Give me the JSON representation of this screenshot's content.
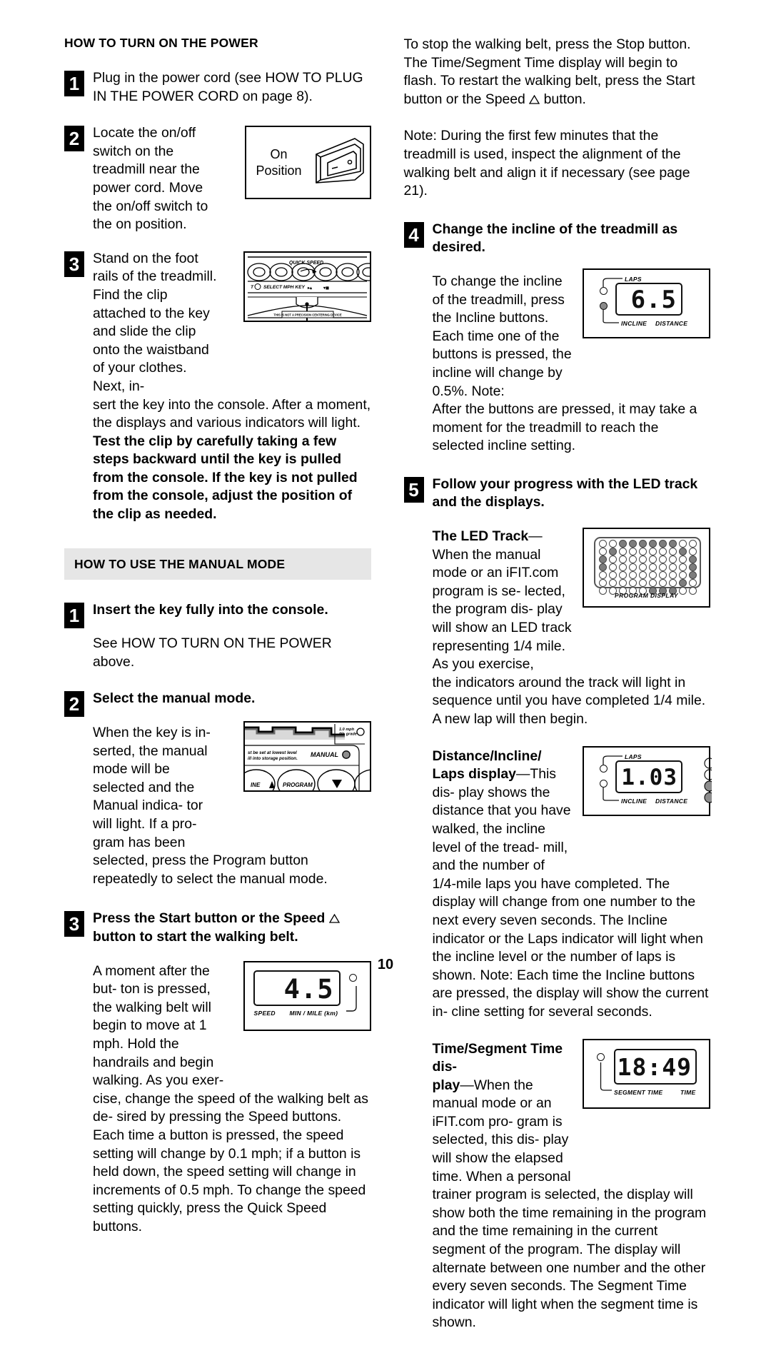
{
  "page": {
    "number": "10"
  },
  "left": {
    "section1": {
      "title": "HOW TO TURN ON THE POWER",
      "steps": [
        {
          "num": "1",
          "text": "Plug in the power cord (see HOW TO PLUG IN THE POWER CORD on page 8)."
        },
        {
          "num": "2",
          "text": "Locate the on/off switch on the treadmill near the power cord. Move the on/off switch to the on position.",
          "figure": {
            "name": "on-position-switch",
            "label_line1": "On",
            "label_line2": "Position"
          }
        },
        {
          "num": "3",
          "text": "Stand on the foot rails of the treadmill. Find the clip attached to the key and slide the clip onto the waistband of your clothes. Next, in-",
          "text_cont": "sert the key into the console. After a moment, the displays and various indicators will light. ",
          "text_bold": "Test the clip by carefully taking a few steps backward until the key is pulled from the console. If the key is not pulled from the console, adjust the position of the clip as needed.",
          "figure": {
            "name": "console-quick-speed",
            "caption_top": "QUICK SPEED",
            "caption_mid": "SELECT MPH KEY",
            "caption_bottom": "THIS IS NOT A PRECISION CENTERING DEVICE"
          }
        }
      ]
    },
    "section2": {
      "title": "HOW TO USE THE MANUAL MODE",
      "steps": [
        {
          "num": "1",
          "heading": "Insert the key fully into the console.",
          "text": "See HOW TO TURN ON THE POWER above."
        },
        {
          "num": "2",
          "heading": "Select the manual mode.",
          "text": "When the key is in- serted, the manual mode will be selected and the Manual indica- tor will light. If a pro- gram has been",
          "text_cont": "selected, press the Program button repeatedly to select the manual mode.",
          "figure": {
            "name": "console-manual-indicator",
            "label_mph": "1.0 mph",
            "label_grade": "0% grade",
            "label_manual": "MANUAL",
            "label_note1": "st be set at lowest level",
            "label_note2": "ill into storage position.",
            "btn_incline": "INE",
            "btn_program": "PROGRAM"
          }
        },
        {
          "num": "3",
          "heading_a": "Press the Start button or the Speed ",
          "heading_b": " button to start the walking belt.",
          "text": "A moment after the but- ton is pressed, the walking belt will begin to move at 1 mph. Hold the handrails and begin walking. As you exer-",
          "text_cont": "cise, change the speed of the walking belt as de- sired by pressing the Speed buttons. Each time a button is pressed, the speed setting will change by 0.1 mph; if a button is held down, the speed setting will change in increments of 0.5 mph. To change the speed setting quickly, press the Quick Speed buttons.",
          "figure": {
            "name": "speed-display",
            "value": "4.5",
            "caption_left": "SPEED",
            "caption_right": "MIN / MILE (km)"
          }
        }
      ]
    }
  },
  "right": {
    "paragraphs": [
      "To stop the walking belt, press the Stop button. The Time/Segment Time display will begin to flash. To restart the walking belt, press the Start button or the Speed",
      "button.",
      "Note: During the first few minutes that the treadmill is used, inspect the alignment of the walking belt and align it if necessary (see page 21)."
    ],
    "steps": [
      {
        "num": "4",
        "heading": "Change the incline of the treadmill as desired.",
        "text": "To change the incline of the treadmill, press the Incline buttons. Each time one of the buttons is pressed, the incline will change by 0.5%. Note:",
        "text_cont": "After the buttons are pressed, it may take a moment for the treadmill to reach the selected incline setting.",
        "figure": {
          "name": "incline-display",
          "value": "6.5",
          "caption_top": "LAPS",
          "caption_bottom_left": "INCLINE",
          "caption_bottom_right": "DISTANCE",
          "indicator_laps_on": false,
          "indicator_incline_on": true
        }
      },
      {
        "num": "5",
        "heading": "Follow your progress with the LED track and the displays.",
        "sub1": {
          "bold": "The LED Track",
          "dash": "—",
          "text": "When the manual mode or an iFIT.com program is se- lected, the program dis- play will show an LED track representing 1/4 mile. As you exercise,",
          "text_cont": "the indicators around the track will light in sequence until you have completed 1/4 mile. A new lap will then begin.",
          "figure": {
            "name": "led-track-program-display",
            "caption": "PROGRAM DISPLAY",
            "rows": 7,
            "cols": 10,
            "lit": [
              [
                0,
                0,
                1,
                1,
                1,
                1,
                1,
                1,
                0,
                0
              ],
              [
                0,
                1,
                0,
                0,
                0,
                0,
                0,
                0,
                1,
                0
              ],
              [
                1,
                0,
                0,
                0,
                0,
                0,
                0,
                0,
                0,
                1
              ],
              [
                1,
                0,
                0,
                0,
                0,
                0,
                0,
                0,
                0,
                1
              ],
              [
                0,
                0,
                0,
                0,
                0,
                0,
                0,
                0,
                0,
                1
              ],
              [
                0,
                0,
                0,
                0,
                0,
                0,
                0,
                0,
                1,
                0
              ],
              [
                0,
                0,
                0,
                0,
                0,
                1,
                1,
                1,
                0,
                0
              ]
            ]
          }
        },
        "sub2": {
          "bold_line1": "Distance/Incline/",
          "bold_line2": "Laps display",
          "dash": "—",
          "text": "This dis- play shows the distance that you have walked, the incline level of the tread- mill, and the number of",
          "text_cont": "1/4-mile laps you have completed. The display will change from one number to the next every seven seconds. The Incline indicator or the Laps indicator will light when the incline level or the number of laps is shown. Note: Each time the Incline buttons are pressed, the display will show the current in- cline setting for several seconds.",
          "figure": {
            "name": "distance-incline-laps-display",
            "value": "1.03",
            "caption_top": "LAPS",
            "caption_bottom_left": "INCLINE",
            "caption_bottom_right": "DISTANCE",
            "indicator_laps_on": false,
            "indicator_incline_on": false
          }
        },
        "sub3": {
          "bold_line1": "Time/Segment Time dis-",
          "bold_line2": "play",
          "dash": "—",
          "text": "When the manual mode or an iFIT.com pro- gram is selected, this dis- play will show the elapsed time. When a personal",
          "text_cont": "trainer program is selected, the display will show both the time remaining in the program and the time remaining in the current segment of the program. The display will alternate between one number and the other every seven seconds. The Segment Time indicator will light when the segment time is shown.",
          "figure": {
            "name": "time-segment-time-display",
            "value": "18:49",
            "caption_left": "SEGMENT TIME",
            "caption_right": "TIME",
            "indicator_segment_on": false
          }
        }
      }
    ]
  }
}
